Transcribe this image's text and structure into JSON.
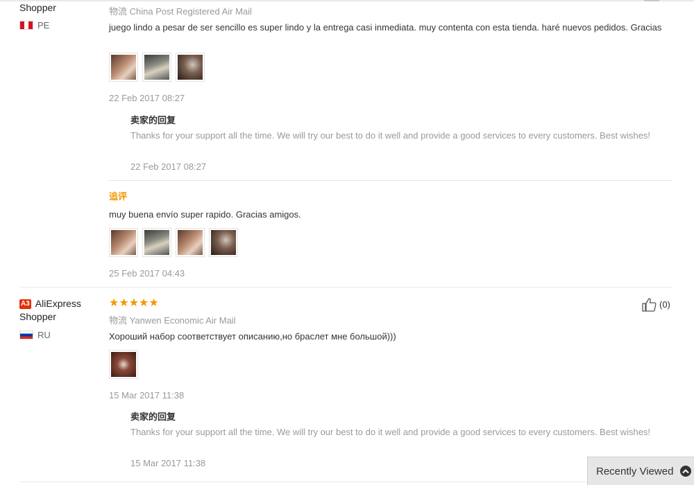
{
  "reviews": [
    {
      "user": {
        "name_tail": "Shopper",
        "country": "PE"
      },
      "logistics": {
        "label": "物流",
        "method": "China Post Registered Air Mail"
      },
      "text": "juego lindo a pesar de ser sencillo es super lindo y la entrega casi inmediata. muy contenta con esta tienda. haré nuevos pedidos. Gracias",
      "images": [
        "photo-wrist-bracelet",
        "photo-wrist-watch",
        "photo-jewelry-closeup"
      ],
      "date": "22 Feb 2017 08:27",
      "reply": {
        "title": "卖家的回复",
        "text": "Thanks for your support all the time. We will try our best to do it well and provide a good services to every customers. Best wishes!",
        "date": "22 Feb 2017 08:27"
      },
      "followup": {
        "label": "追评",
        "text": "muy buena envío super rapido. Gracias amigos.",
        "images": [
          "photo-wrist-1",
          "photo-wrist-2",
          "photo-wrist-3",
          "photo-wrist-4"
        ],
        "date": "25 Feb 2017 04:43"
      }
    },
    {
      "user": {
        "badge": "A3",
        "name": "AliExpress",
        "name_tail": "Shopper",
        "country": "RU"
      },
      "rating": 5,
      "stars": "★★★★★",
      "logistics": {
        "label": "物流",
        "method": "Yanwen Economic Air Mail"
      },
      "text": "Хороший набор соответствует описанию,но браслет мне большой)))",
      "images": [
        "photo-bracelet-box"
      ],
      "date": "15 Mar 2017 11:38",
      "likes": "(0)",
      "reply": {
        "title": "卖家的回复",
        "text": "Thanks for your support all the time. We will try our best to do it well and provide a good services to every customers. Best wishes!",
        "date": "15 Mar 2017 11:38"
      }
    }
  ],
  "recently_viewed": {
    "label": "Recently Viewed",
    "icon": "chevron-up-icon"
  },
  "colors": {
    "accent_orange": "#f39800",
    "badge_red": "#e62e04",
    "muted_text": "#999999"
  }
}
